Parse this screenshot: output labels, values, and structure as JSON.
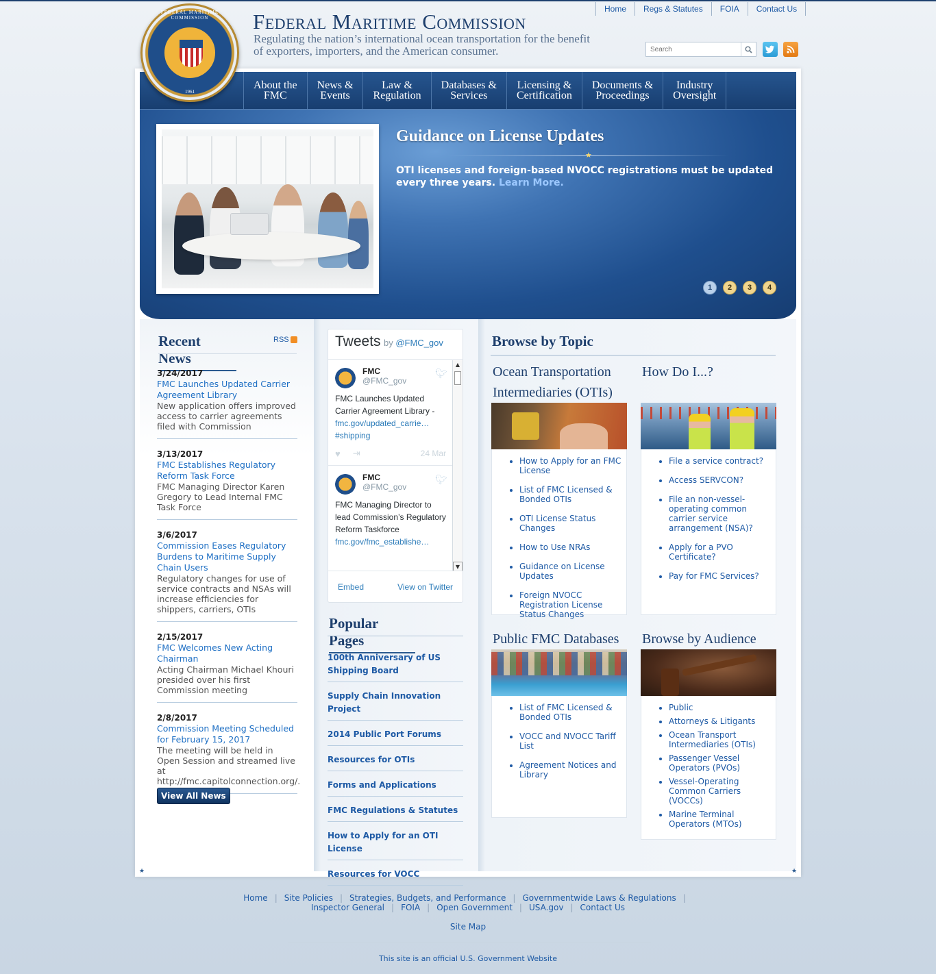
{
  "utility_nav": [
    "Home",
    "Regs & Statutes",
    "FOIA",
    "Contact Us"
  ],
  "site": {
    "title": "Federal Maritime Commission",
    "tagline": "Regulating the nation’s international ocean transportation for the benefit of exporters, importers, and the American consumer.",
    "seal_text": "FEDERAL MARITIME COMMISSION",
    "seal_year": "1961"
  },
  "search": {
    "placeholder": "Search"
  },
  "main_nav": [
    {
      "line1": "About the",
      "line2": "FMC"
    },
    {
      "line1": "News &",
      "line2": "Events"
    },
    {
      "line1": "Law &",
      "line2": "Regulation"
    },
    {
      "line1": "Databases &",
      "line2": "Services"
    },
    {
      "line1": "Licensing &",
      "line2": "Certification"
    },
    {
      "line1": "Documents &",
      "line2": "Proceedings"
    },
    {
      "line1": "Industry",
      "line2": "Oversight"
    }
  ],
  "hero": {
    "title": "Guidance on License Updates",
    "text": "OTI licenses and foreign-based NVOCC registrations must be updated every three years.",
    "link": "Learn More.",
    "dots": [
      "1",
      "2",
      "3",
      "4"
    ],
    "active_dot": 1
  },
  "recent_news": {
    "title": "Recent News",
    "rss_label": "RSS",
    "items": [
      {
        "date": "3/24/2017",
        "title": "FMC Launches Updated Carrier Agreement Library",
        "desc": "New application offers improved access to carrier agreements filed with Commission"
      },
      {
        "date": "3/13/2017",
        "title": "FMC Establishes Regulatory Reform Task Force",
        "desc": "FMC Managing Director Karen Gregory to Lead Internal FMC Task Force"
      },
      {
        "date": "3/6/2017",
        "title": "Commission Eases Regulatory Burdens to Maritime Supply Chain Users",
        "desc": "Regulatory changes for use of service contracts and NSAs will increase efficiencies for shippers, carriers, OTIs"
      },
      {
        "date": "2/15/2017",
        "title": "FMC Welcomes New Acting Chairman",
        "desc": "Acting Chairman Michael Khouri presided over his first Commission meeting"
      },
      {
        "date": "2/8/2017",
        "title": "Commission Meeting Scheduled for February 15, 2017",
        "desc": "The meeting will be held in Open Session and streamed live at http://fmc.capitolconnection.org/."
      }
    ],
    "view_all": "View All News"
  },
  "tweets": {
    "title": "Tweets",
    "by": "by",
    "handle_link": "@FMC_gov",
    "items": [
      {
        "name": "FMC",
        "handle": "@FMC_gov",
        "text": "FMC Launches Updated Carrier Agreement Library -",
        "link1": "fmc.gov/updated_carrie…",
        "link2": "#shipping",
        "date": "24 Mar"
      },
      {
        "name": "FMC",
        "handle": "@FMC_gov",
        "text": "FMC Managing Director to lead Commission’s Regulatory Reform Taskforce",
        "link1": "fmc.gov/fmc_establishe…",
        "link2": "",
        "date": ""
      }
    ],
    "embed": "Embed",
    "view_on_twitter": "View on Twitter"
  },
  "popular_pages": {
    "title": "Popular Pages",
    "items": [
      "100th Anniversary of US Shipping Board",
      "Supply Chain Innovation Project",
      "2014 Public Port Forums",
      "Resources for OTIs",
      "Forms and Applications",
      "FMC Regulations & Statutes",
      "How to Apply for an OTI License",
      "Resources for VOCC"
    ]
  },
  "browse": {
    "title": "Browse by Topic",
    "otis": {
      "title": "Ocean Transportation Intermediaries (OTIs)",
      "items": [
        "How to Apply for an FMC License",
        "List of FMC Licensed & Bonded OTIs",
        "OTI License Status Changes",
        "How to Use NRAs",
        "Guidance on License Updates",
        "Foreign NVOCC Registration License Status Changes"
      ]
    },
    "howdoi": {
      "title": "How Do I...?",
      "items": [
        "File a service contract?",
        "Access SERVCON?",
        "File an non-vessel-operating common carrier service arrangement (NSA)?",
        "Apply for a PVO Certificate?",
        "Pay for FMC Services?"
      ]
    },
    "databases": {
      "title": "Public FMC Databases",
      "items": [
        "List of FMC Licensed & Bonded OTIs",
        "VOCC and NVOCC Tariff List",
        "Agreement Notices and Library"
      ]
    },
    "audience": {
      "title": "Browse by Audience",
      "items": [
        "Public",
        "Attorneys & Litigants",
        "Ocean Transport Intermediaries (OTIs)",
        "Passenger Vessel Operators (PVOs)",
        "Vessel-Operating Common Carriers (VOCCs)",
        "Marine Terminal Operators (MTOs)"
      ]
    }
  },
  "footer": {
    "row1": [
      "Home",
      "Site Policies",
      "Strategies, Budgets, and Performance",
      "Governmentwide Laws & Regulations"
    ],
    "row2": [
      "Inspector General",
      "FOIA",
      "Open Government",
      "USA.gov",
      "Contact Us"
    ],
    "sitemap": "Site Map",
    "gov_note": "This site is an official U.S. Government Website"
  },
  "colors": {
    "navy": "#1e3f6d",
    "link": "#1e5aa5",
    "hero": "#1f4f8e"
  }
}
